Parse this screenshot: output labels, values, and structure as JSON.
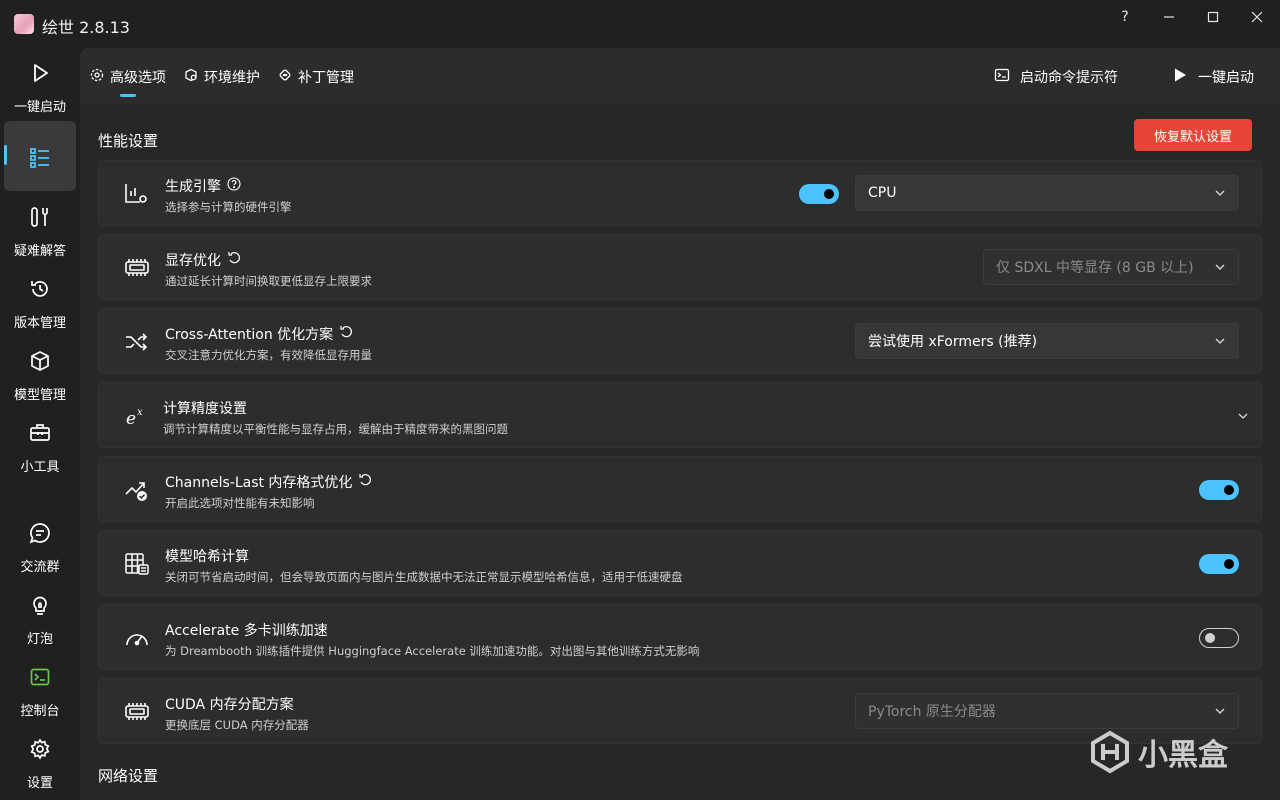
{
  "window": {
    "title": "绘世 2.8.13"
  },
  "sidebar": {
    "items": [
      {
        "label": "一键启动",
        "icon": "play-icon"
      },
      {
        "label": "",
        "icon": "list-icon"
      },
      {
        "label": "疑难解答",
        "icon": "tools-icon"
      },
      {
        "label": "版本管理",
        "icon": "history-icon"
      },
      {
        "label": "模型管理",
        "icon": "cube-icon"
      },
      {
        "label": "小工具",
        "icon": "toolbox-icon"
      },
      {
        "label": "交流群",
        "icon": "chat-icon"
      },
      {
        "label": "灯泡",
        "icon": "bulb-icon"
      },
      {
        "label": "控制台",
        "icon": "console-icon"
      },
      {
        "label": "设置",
        "icon": "gear-icon"
      }
    ]
  },
  "tabs": [
    {
      "label": "高级选项"
    },
    {
      "label": "环境维护"
    },
    {
      "label": "补丁管理"
    }
  ],
  "header_actions": {
    "terminal": "启动命令提示符",
    "launch": "一键启动"
  },
  "sections": {
    "performance": "性能设置",
    "network": "网络设置"
  },
  "reset_button": "恢复默认设置",
  "settings": [
    {
      "title": "生成引擎",
      "desc": "选择参与计算的硬件引擎",
      "select": "CPU",
      "toggle": "on"
    },
    {
      "title": "显存优化",
      "desc": "通过延长计算时间换取更低显存上限要求",
      "select": "仅 SDXL 中等显存 (8 GB 以上)"
    },
    {
      "title": "Cross-Attention 优化方案",
      "desc": "交叉注意力优化方案，有效降低显存用量",
      "select": "尝试使用 xFormers (推荐)"
    },
    {
      "title": "计算精度设置",
      "desc": "调节计算精度以平衡性能与显存占用，缓解由于精度带来的黑图问题"
    },
    {
      "title": "Channels-Last 内存格式优化",
      "desc": "开启此选项对性能有未知影响",
      "toggle": "on"
    },
    {
      "title": "模型哈希计算",
      "desc": "关闭可节省启动时间，但会导致页面内与图片生成数据中无法正常显示模型哈希信息，适用于低速硬盘",
      "toggle": "on"
    },
    {
      "title": "Accelerate 多卡训练加速",
      "desc": "为 Dreambooth 训练插件提供 Huggingface Accelerate 训练加速功能。对出图与其他训练方式无影响",
      "toggle": "off"
    },
    {
      "title": "CUDA 内存分配方案",
      "desc": "更换底层 CUDA 内存分配器",
      "select": "PyTorch 原生分配器"
    }
  ],
  "watermark": "小黑盒",
  "colors": {
    "accent": "#4cc2ff",
    "danger": "#e64537",
    "bg": "#202020",
    "card": "#2d2d2d"
  }
}
